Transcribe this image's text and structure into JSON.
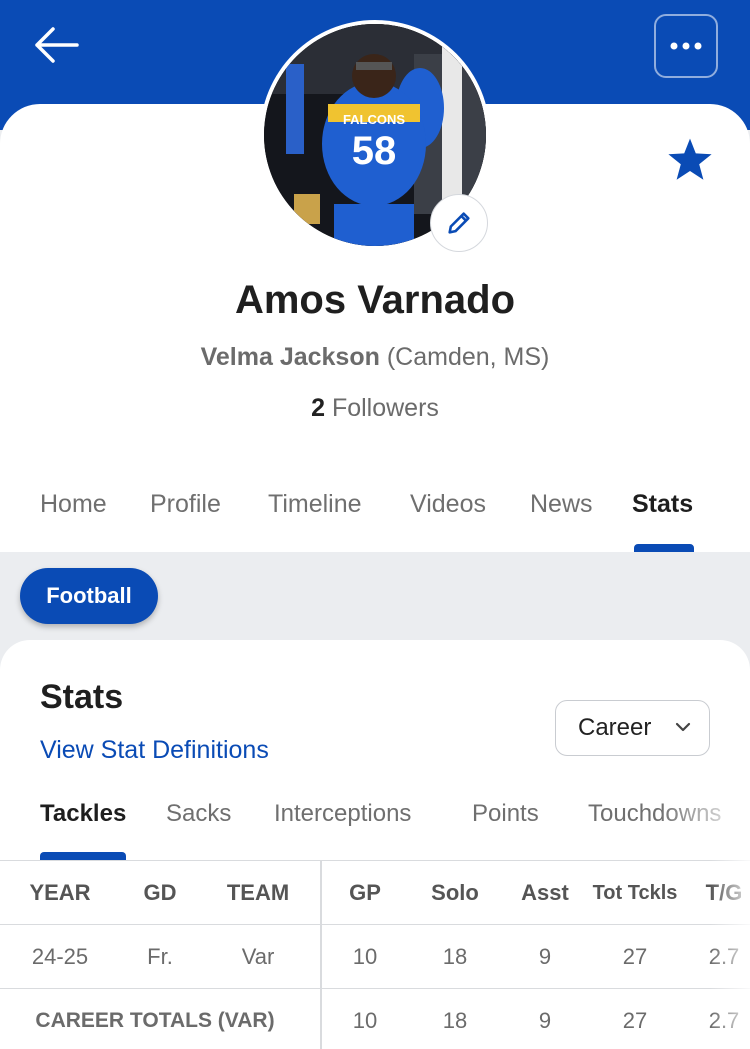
{
  "header": {
    "back_icon": "arrow-left-icon",
    "more_icon": "more-horizontal-icon",
    "favorite_icon": "star-icon",
    "edit_icon": "pencil-icon",
    "avatar_jersey": "58",
    "avatar_team_text": "FALCONS"
  },
  "profile": {
    "name": "Amos Varnado",
    "school": "Velma Jackson",
    "location": "(Camden, MS)",
    "followers_count": "2",
    "followers_label": "Followers"
  },
  "nav": {
    "tabs": [
      "Home",
      "Profile",
      "Timeline",
      "Videos",
      "News",
      "Stats"
    ],
    "active": "Stats"
  },
  "sport": {
    "selected": "Football"
  },
  "stats": {
    "title": "Stats",
    "definitions_link": "View Stat Definitions",
    "season_select": "Career",
    "tabs": [
      "Tackles",
      "Sacks",
      "Interceptions",
      "Points",
      "Touchdowns"
    ],
    "active_tab": "Tackles",
    "columns": [
      "YEAR",
      "GD",
      "TEAM",
      "GP",
      "Solo",
      "Asst",
      "Tot Tckls",
      "T/G"
    ],
    "rows": [
      [
        "24-25",
        "Fr.",
        "Var",
        "10",
        "18",
        "9",
        "27",
        "2.7"
      ]
    ],
    "totals": {
      "label": "CAREER TOTALS (VAR)",
      "values": [
        "10",
        "18",
        "9",
        "27",
        "2.7"
      ]
    }
  },
  "colors": {
    "brand": "#0a4bb5",
    "background": "#ebedf0"
  }
}
